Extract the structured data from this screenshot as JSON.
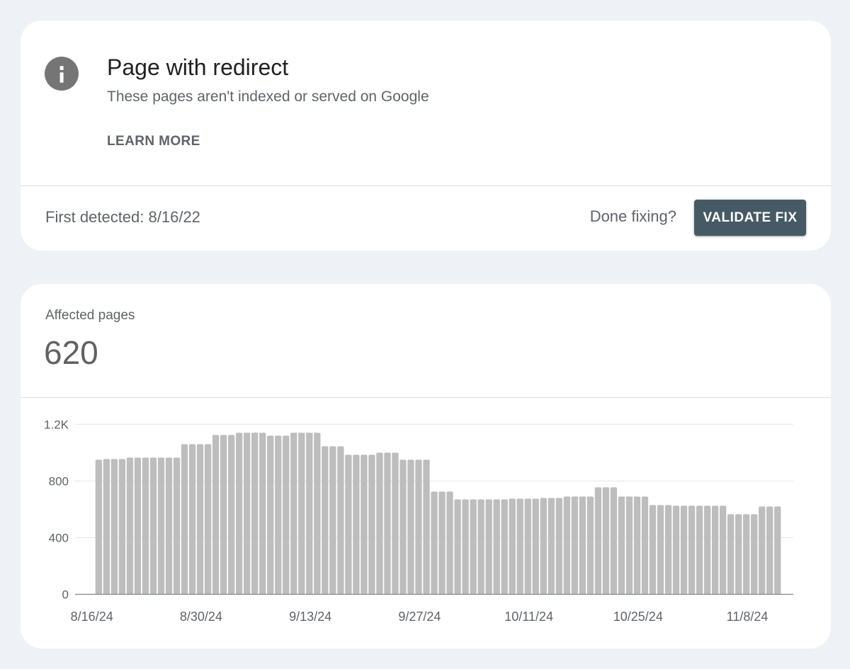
{
  "issue_card": {
    "icon": "info-icon",
    "title": "Page with redirect",
    "subtitle": "These pages aren't indexed or served on Google",
    "learn_more_label": "LEARN MORE",
    "first_detected_label": "First detected:",
    "first_detected_value": "8/16/22",
    "done_fixing_label": "Done fixing?",
    "validate_fix_label": "VALIDATE FIX"
  },
  "affected_card": {
    "label": "Affected pages",
    "value": "620"
  },
  "colors": {
    "page_background": "#eef2f6",
    "validate_button": "#455a64",
    "info_icon": "#757575",
    "bar": "#bdbdbd",
    "gridline": "#e6e6e6",
    "axis": "#80868b",
    "title_text": "#202124",
    "secondary_text": "#5f6368"
  },
  "chart_data": {
    "type": "bar",
    "title": "",
    "xlabel": "",
    "ylabel": "",
    "series_name": "Affected pages",
    "x": [
      "8/16/24",
      "8/17/24",
      "8/18/24",
      "8/19/24",
      "8/20/24",
      "8/21/24",
      "8/22/24",
      "8/23/24",
      "8/24/24",
      "8/25/24",
      "8/26/24",
      "8/27/24",
      "8/28/24",
      "8/29/24",
      "8/30/24",
      "8/31/24",
      "9/1/24",
      "9/2/24",
      "9/3/24",
      "9/4/24",
      "9/5/24",
      "9/6/24",
      "9/7/24",
      "9/8/24",
      "9/9/24",
      "9/10/24",
      "9/11/24",
      "9/12/24",
      "9/13/24",
      "9/14/24",
      "9/15/24",
      "9/16/24",
      "9/17/24",
      "9/18/24",
      "9/19/24",
      "9/20/24",
      "9/21/24",
      "9/22/24",
      "9/23/24",
      "9/24/24",
      "9/25/24",
      "9/26/24",
      "9/27/24",
      "9/28/24",
      "9/29/24",
      "9/30/24",
      "10/1/24",
      "10/2/24",
      "10/3/24",
      "10/4/24",
      "10/5/24",
      "10/6/24",
      "10/7/24",
      "10/8/24",
      "10/9/24",
      "10/10/24",
      "10/11/24",
      "10/12/24",
      "10/13/24",
      "10/14/24",
      "10/15/24",
      "10/16/24",
      "10/17/24",
      "10/18/24",
      "10/19/24",
      "10/20/24",
      "10/21/24",
      "10/22/24",
      "10/23/24",
      "10/24/24",
      "10/25/24",
      "10/26/24",
      "10/27/24",
      "10/28/24",
      "10/29/24",
      "10/30/24",
      "10/31/24",
      "11/1/24",
      "11/2/24",
      "11/3/24",
      "11/4/24",
      "11/5/24",
      "11/6/24",
      "11/7/24",
      "11/8/24",
      "11/9/24",
      "11/10/24",
      "11/11/24"
    ],
    "values": [
      950,
      955,
      955,
      955,
      965,
      965,
      965,
      965,
      965,
      965,
      965,
      1060,
      1060,
      1060,
      1060,
      1125,
      1125,
      1125,
      1140,
      1140,
      1140,
      1140,
      1120,
      1120,
      1120,
      1140,
      1140,
      1140,
      1140,
      1045,
      1045,
      1045,
      985,
      985,
      985,
      985,
      1000,
      1000,
      1000,
      950,
      950,
      950,
      950,
      725,
      725,
      725,
      670,
      670,
      670,
      670,
      670,
      670,
      670,
      675,
      675,
      675,
      675,
      680,
      680,
      680,
      690,
      690,
      690,
      690,
      755,
      755,
      755,
      690,
      690,
      690,
      690,
      630,
      630,
      630,
      625,
      625,
      625,
      625,
      625,
      625,
      625,
      565,
      565,
      565,
      565,
      620,
      620,
      620
    ],
    "ylim": [
      0,
      1200
    ],
    "yticks": [
      0,
      400,
      800,
      1200
    ],
    "ytick_labels": [
      "0",
      "400",
      "800",
      "1.2K"
    ],
    "xtick_labels": [
      "8/16/24",
      "8/30/24",
      "9/13/24",
      "9/27/24",
      "10/11/24",
      "10/25/24",
      "11/8/24"
    ],
    "grid": true,
    "legend": "none"
  }
}
